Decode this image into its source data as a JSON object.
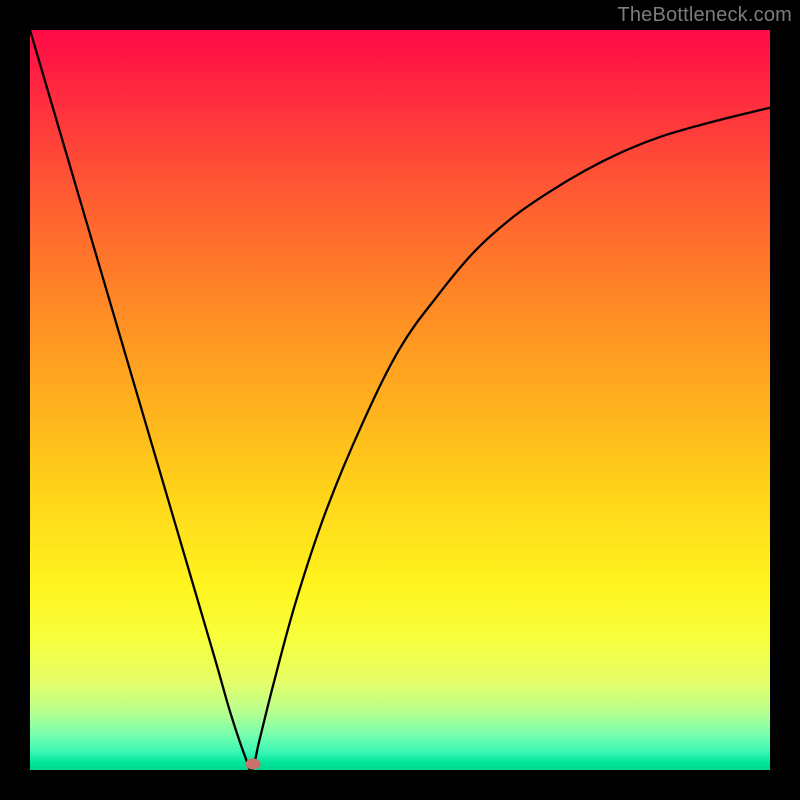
{
  "attribution": "TheBottleneck.com",
  "chart_data": {
    "type": "line",
    "title": "",
    "xlabel": "",
    "ylabel": "",
    "xlim": [
      0,
      100
    ],
    "ylim": [
      0,
      100
    ],
    "x": [
      0,
      5,
      10,
      15,
      20,
      25,
      27,
      29,
      30,
      31,
      33,
      36,
      40,
      45,
      50,
      55,
      60,
      65,
      70,
      75,
      80,
      85,
      90,
      95,
      100
    ],
    "values": [
      100,
      83,
      66,
      49,
      32,
      15,
      8,
      2,
      0,
      4,
      12,
      23,
      35,
      47,
      57,
      64,
      70,
      74.5,
      78,
      81,
      83.5,
      85.5,
      87,
      88.3,
      89.5
    ],
    "min_point": {
      "x": 30,
      "y": 0
    },
    "background_gradient": [
      "#ff0a47",
      "#ff8327",
      "#fff41e",
      "#00d88e"
    ]
  },
  "plot": {
    "min_marker_left_px": 223,
    "min_marker_top_px": 734
  }
}
